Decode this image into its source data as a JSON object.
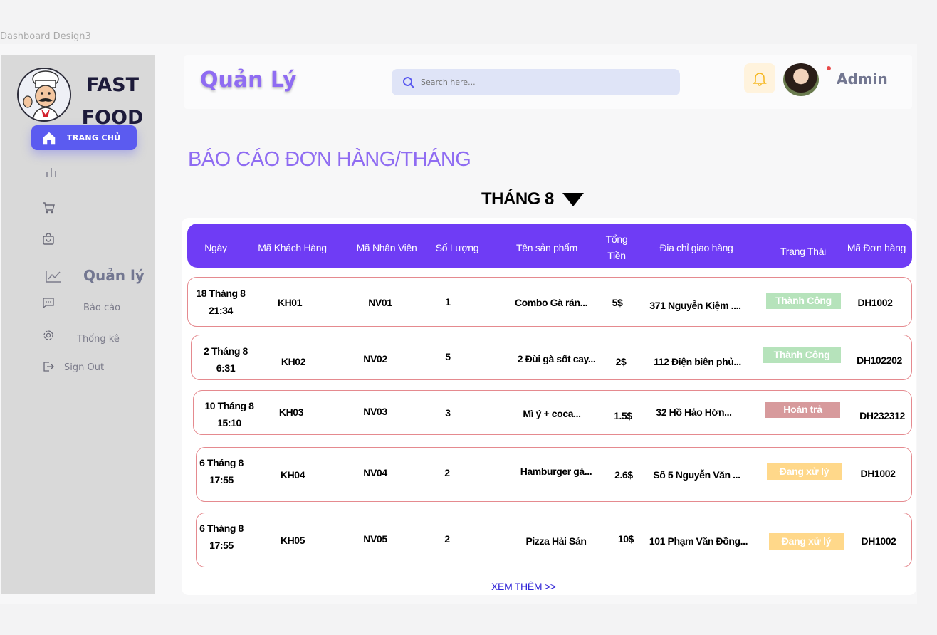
{
  "frame_label": "Dashboard Design3",
  "logo": {
    "line1": "FAST",
    "line2": "FOOD"
  },
  "sidebar": {
    "home_label": "TRANG CHỦ",
    "section_label": "Quản lý",
    "items": [
      {
        "label": "Báo cáo",
        "icon": "message-icon"
      },
      {
        "label": "Thống kê",
        "icon": "gear-icon"
      },
      {
        "label": "Sign Out",
        "icon": "sign-out-icon"
      }
    ]
  },
  "header": {
    "brand": "Quản Lý",
    "search_placeholder": "Search here...",
    "user": "Admin"
  },
  "report": {
    "title": "BÁO CÁO ĐƠN HÀNG/THÁNG",
    "month": "THÁNG 8",
    "columns": [
      "Ngày",
      "Mã Khách Hàng",
      "Mã Nhân Viên",
      "Số Lượng",
      "Tên sản phẩm",
      "Tổng",
      "Tiền",
      "Đia chỉ giao hàng",
      "Trạng Thái",
      "Mã Đơn hàng"
    ],
    "rows": [
      {
        "day": "18 Tháng 8",
        "time": "21:34",
        "customer": "KH01",
        "staff": "NV01",
        "qty": "1",
        "product": "Combo Gà rán...",
        "total": "5$",
        "address": "371 Nguyễn Kiệm ....",
        "status": "Thành Công",
        "order": "DH1002"
      },
      {
        "day": "2 Tháng 8",
        "time": "6:31",
        "customer": "KH02",
        "staff": "NV02",
        "qty": "5",
        "product": "2 Đùi gà sốt cay...",
        "total": "2$",
        "address": "112 Điện biên phủ...",
        "status": "Thành Công",
        "order": "DH102202"
      },
      {
        "day": "10 Tháng 8",
        "time": "15:10",
        "customer": "KH03",
        "staff": "NV03",
        "qty": "3",
        "product": "Mì ý + coca...",
        "total": "1.5$",
        "address": "32 Hồ Hảo Hớn...",
        "status": "Hoàn trả",
        "order": "DH232312"
      },
      {
        "day": "6 Tháng 8",
        "time": "17:55",
        "customer": "KH04",
        "staff": "NV04",
        "qty": "2",
        "product": "Hamburger gà...",
        "total": "2.6$",
        "address": "Số 5 Nguyễn Văn ...",
        "status": "Đang xử lý",
        "order": "DH1002"
      },
      {
        "day": "6 Tháng 8",
        "time": "17:55",
        "customer": "KH05",
        "staff": "NV05",
        "qty": "2",
        "product": "Pizza  Hải Sản",
        "total": "10$",
        "address": "101 Phạm Văn Đồng...",
        "status": "Đang xử lý",
        "order": "DH1002"
      }
    ],
    "more": "XEM THÊM >>"
  },
  "colors": {
    "accent": "#6f3cf5",
    "brand": "#8f6cf2",
    "success": "#b6e3bb",
    "returned": "#d79a9c",
    "processing": "#ffd88a"
  }
}
